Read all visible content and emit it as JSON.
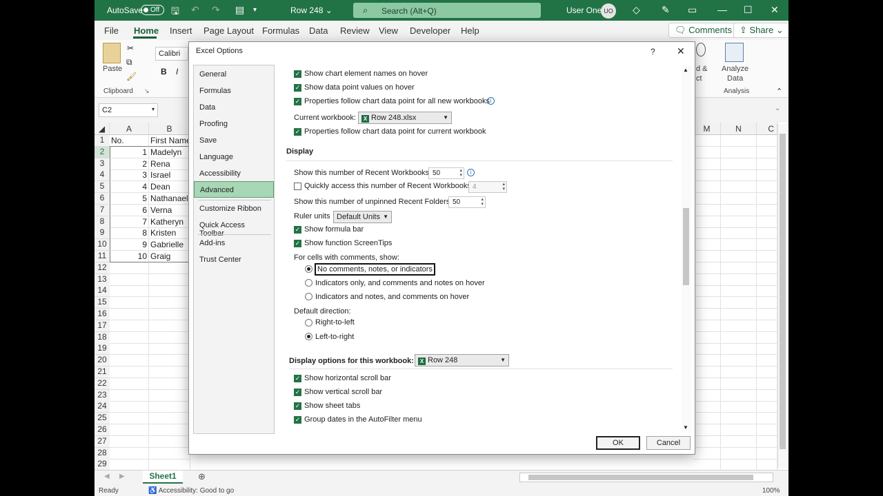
{
  "titlebar": {
    "autosave_label": "AutoSave",
    "autosave_state": "Off",
    "filename": "Row 248",
    "search_placeholder": "Search (Alt+Q)",
    "user_name": "User One",
    "user_initials": "UO"
  },
  "menu": {
    "items": [
      "File",
      "Home",
      "Insert",
      "Page Layout",
      "Formulas",
      "Data",
      "Review",
      "View",
      "Developer",
      "Help"
    ],
    "comments_label": "Comments",
    "share_label": "Share"
  },
  "ribbon": {
    "paste_label": "Paste",
    "clipboard_label": "Clipboard",
    "font_name": "Calibri",
    "analyze_data_label_1": "Analyze",
    "analyze_data_label_2": "Data",
    "analysis_label": "Analysis",
    "partial_1": "d &",
    "partial_2": "ct"
  },
  "formula_bar": {
    "name_box": "C2"
  },
  "sheet": {
    "columns": [
      "A",
      "B",
      "M",
      "N",
      "C"
    ],
    "header_row": {
      "a": "No.",
      "b": "First Name"
    },
    "rows": [
      {
        "n": "1",
        "name": "Madelyn"
      },
      {
        "n": "2",
        "name": "Rena"
      },
      {
        "n": "3",
        "name": "Israel"
      },
      {
        "n": "4",
        "name": "Dean"
      },
      {
        "n": "5",
        "name": "Nathanael"
      },
      {
        "n": "6",
        "name": "Verna"
      },
      {
        "n": "7",
        "name": "Katheryn"
      },
      {
        "n": "8",
        "name": "Kristen"
      },
      {
        "n": "9",
        "name": "Gabrielle"
      },
      {
        "n": "10",
        "name": "Graig"
      }
    ],
    "row_numbers": [
      "1",
      "2",
      "3",
      "4",
      "5",
      "6",
      "7",
      "8",
      "9",
      "10",
      "11",
      "12",
      "13",
      "14",
      "15",
      "16",
      "17",
      "18",
      "19",
      "20",
      "21",
      "22",
      "23",
      "24",
      "25",
      "26",
      "27",
      "28",
      "29"
    ],
    "tab_name": "Sheet1",
    "status_ready": "Ready",
    "status_accessibility": "Accessibility: Good to go",
    "zoom": "100%"
  },
  "dialog": {
    "title": "Excel Options",
    "help": "?",
    "close": "✕",
    "nav": [
      "General",
      "Formulas",
      "Data",
      "Proofing",
      "Save",
      "Language",
      "Accessibility",
      "Advanced",
      "Customize Ribbon",
      "Quick Access Toolbar",
      "Add-ins",
      "Trust Center"
    ],
    "opts": {
      "chart_names": "Show chart element names on hover",
      "data_point_values": "Show data point values on hover",
      "props_all": "Properties follow chart data point for all new workbooks",
      "current_workbook_label": "Current workbook:",
      "current_workbook_value": "Row 248.xlsx",
      "props_current": "Properties follow chart data point for current workbook",
      "display_section": "Display",
      "recent_workbooks_label": "Show this number of Recent Workbooks:",
      "recent_workbooks_value": "50",
      "quick_access_label": "Quickly access this number of Recent Workbooks:",
      "quick_access_value": "4",
      "unpinned_folders_label": "Show this number of unpinned Recent Folders:",
      "unpinned_folders_value": "50",
      "ruler_units_label": "Ruler units",
      "ruler_units_value": "Default Units",
      "formula_bar": "Show formula bar",
      "screentips": "Show function ScreenTips",
      "comments_heading": "For cells with comments, show:",
      "comments_none": "No comments, notes, or indicators",
      "comments_indicators_only": "Indicators only, and comments and notes on hover",
      "comments_indicators_notes": "Indicators and notes, and comments on hover",
      "direction_heading": "Default direction:",
      "rtl": "Right-to-left",
      "ltr": "Left-to-right",
      "workbook_section": "Display options for this workbook:",
      "workbook_value": "Row 248",
      "h_scroll": "Show horizontal scroll bar",
      "v_scroll": "Show vertical scroll bar",
      "sheet_tabs": "Show sheet tabs",
      "group_dates": "Group dates in the AutoFilter menu"
    },
    "ok_label": "OK",
    "cancel_label": "Cancel"
  }
}
